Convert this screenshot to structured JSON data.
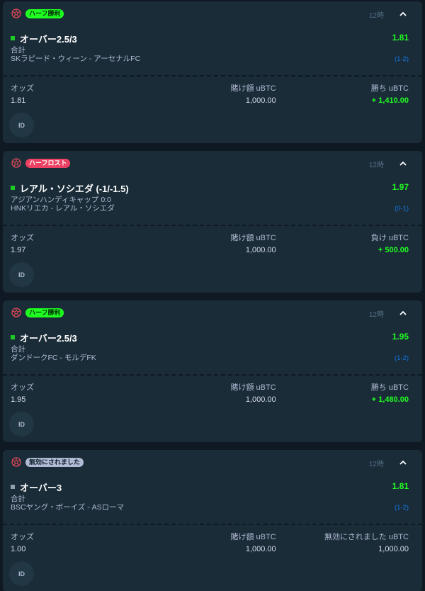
{
  "colors": {
    "background": "#0f1923",
    "card": "#1a2c38",
    "win_green": "#1fff20",
    "loss_red": "#ed4163",
    "link_blue": "#1475e1"
  },
  "bets": [
    {
      "badge": "ハーフ勝利",
      "badge_type": "win",
      "time": "12時",
      "selection": "オーバー2.5/3",
      "odds": "1.81",
      "market": "合計",
      "match": "SKラピード・ウィーン - アーセナルFC",
      "score": "(1-2)",
      "odds_label": "オッズ",
      "odds_value": "1.81",
      "stake_label": "賭け額 uBTC",
      "stake_value": "1,000.00",
      "result_label": "勝ち uBTC",
      "result_value": "+ 1,410.00",
      "id_label": "ID"
    },
    {
      "badge": "ハーフロスト",
      "badge_type": "loss",
      "time": "12時",
      "selection": "レアル・ソシエダ (-1/-1.5)",
      "odds": "1.97",
      "market": "アジアンハンディキャップ 0:0",
      "match": "HNKリエカ - レアル・ソシエダ",
      "score": "(0-1)",
      "odds_label": "オッズ",
      "odds_value": "1.97",
      "stake_label": "賭け額 uBTC",
      "stake_value": "1,000.00",
      "result_label": "負け uBTC",
      "result_value": "+ 500.00",
      "id_label": "ID"
    },
    {
      "badge": "ハーフ勝利",
      "badge_type": "win",
      "time": "12時",
      "selection": "オーバー2.5/3",
      "odds": "1.95",
      "market": "合計",
      "match": "ダンドークFC - モルデFK",
      "score": "(1-2)",
      "odds_label": "オッズ",
      "odds_value": "1.95",
      "stake_label": "賭け額 uBTC",
      "stake_value": "1,000.00",
      "result_label": "勝ち uBTC",
      "result_value": "+ 1,480.00",
      "id_label": "ID"
    },
    {
      "badge": "無効にされました",
      "badge_type": "void",
      "time": "12時",
      "selection": "オーバー3",
      "odds": "1.81",
      "market": "合計",
      "match": "BSCヤング・ボーイズ - ASローマ",
      "score": "(1-2)",
      "odds_label": "オッズ",
      "odds_value": "1.00",
      "stake_label": "賭け額 uBTC",
      "stake_value": "1,000.00",
      "result_label": "無効にされました uBTC",
      "result_value": "1,000.00",
      "id_label": "ID"
    }
  ],
  "icons": {
    "sport": "soccer-ball-icon",
    "collapse": "chevron-up-icon"
  }
}
